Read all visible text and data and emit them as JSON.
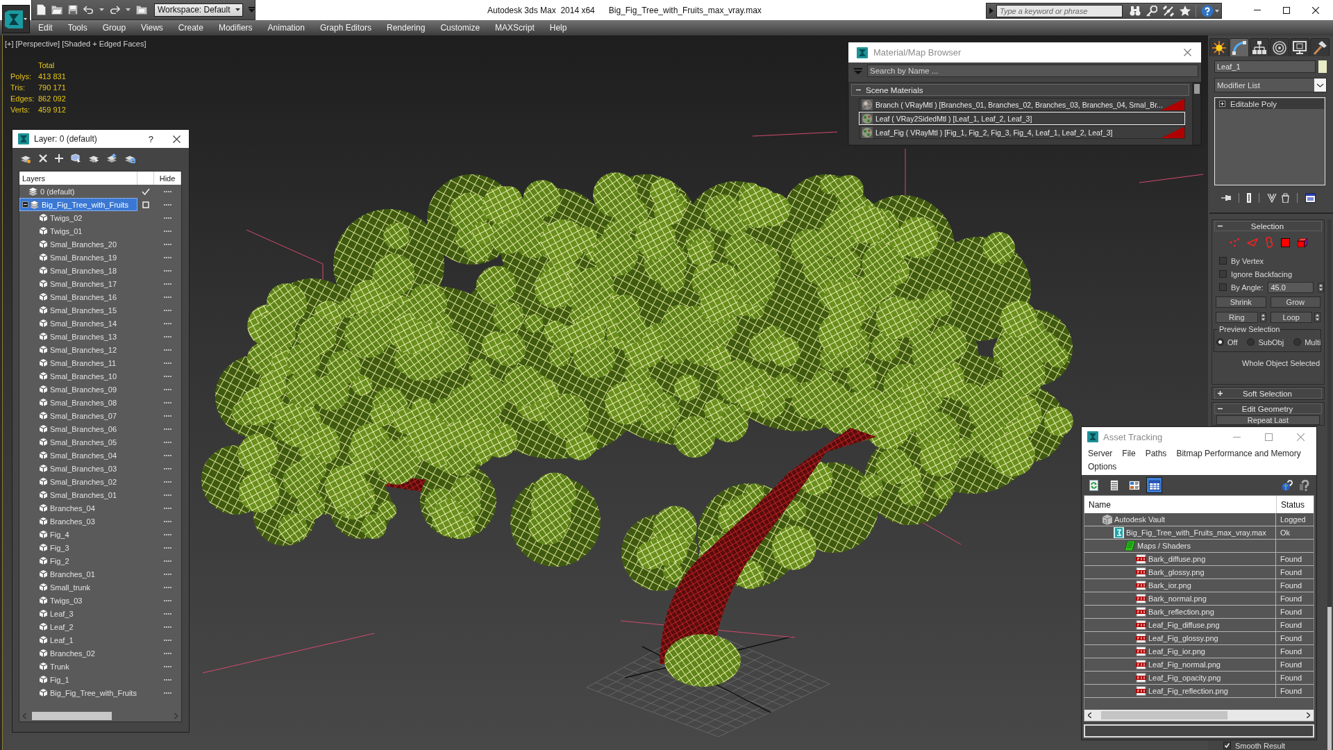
{
  "title_bar": {
    "workspace": "Workspace: Default",
    "app_title": "Autodesk 3ds Max  2014 x64",
    "file_name": "Big_Fig_Tree_with_Fruits_max_vray.max",
    "search": {
      "placeholder": "Type a keyword or phrase"
    }
  },
  "menu_bar": [
    "Edit",
    "Tools",
    "Group",
    "Views",
    "Create",
    "Modifiers",
    "Animation",
    "Graph Editors",
    "Rendering",
    "Customize",
    "MAXScript",
    "Help"
  ],
  "viewport": {
    "labels": [
      "[+]",
      "[Perspective]",
      "[Shaded + Edged Faces]"
    ],
    "stats": {
      "heading": "Total",
      "rows": [
        {
          "label": "Polys:",
          "value": "413 831"
        },
        {
          "label": "Tris:",
          "value": "790 171"
        },
        {
          "label": "Edges:",
          "value": "862 092"
        },
        {
          "label": "Verts:",
          "value": "459 912"
        }
      ]
    }
  },
  "layer_explorer": {
    "title": "Layer: 0 (default)",
    "help": "?",
    "columns": [
      "Layers",
      "Hide"
    ],
    "layers": [
      {
        "kind": "layer",
        "name": "0 (default)",
        "current": true,
        "selected": false
      },
      {
        "kind": "layer",
        "name": "Big_Fig_Tree_with_Fruits",
        "current": false,
        "selected": true,
        "expanded": true,
        "children": [
          {
            "kind": "object",
            "name": "Twigs_02",
            "selected": false
          },
          {
            "kind": "object",
            "name": "Twigs_01",
            "selected": false
          },
          {
            "kind": "object",
            "name": "Smal_Branches_20",
            "selected": false
          },
          {
            "kind": "object",
            "name": "Smal_Branches_19",
            "selected": false
          },
          {
            "kind": "object",
            "name": "Smal_Branches_18",
            "selected": false
          },
          {
            "kind": "object",
            "name": "Smal_Branches_17",
            "selected": false
          },
          {
            "kind": "object",
            "name": "Smal_Branches_16",
            "selected": false
          },
          {
            "kind": "object",
            "name": "Smal_Branches_15",
            "selected": false
          },
          {
            "kind": "object",
            "name": "Smal_Branches_14",
            "selected": false
          },
          {
            "kind": "object",
            "name": "Smal_Branches_13",
            "selected": false
          },
          {
            "kind": "object",
            "name": "Smal_Branches_12",
            "selected": false
          },
          {
            "kind": "object",
            "name": "Smal_Branches_11",
            "selected": false
          },
          {
            "kind": "object",
            "name": "Smal_Branches_10",
            "selected": false
          },
          {
            "kind": "object",
            "name": "Smal_Branches_09",
            "selected": false
          },
          {
            "kind": "object",
            "name": "Smal_Branches_08",
            "selected": false
          },
          {
            "kind": "object",
            "name": "Smal_Branches_07",
            "selected": false
          },
          {
            "kind": "object",
            "name": "Smal_Branches_06",
            "selected": false
          },
          {
            "kind": "object",
            "name": "Smal_Branches_05",
            "selected": false
          },
          {
            "kind": "object",
            "name": "Smal_Branches_04",
            "selected": false
          },
          {
            "kind": "object",
            "name": "Smal_Branches_03",
            "selected": false
          },
          {
            "kind": "object",
            "name": "Smal_Branches_02",
            "selected": false
          },
          {
            "kind": "object",
            "name": "Smal_Branches_01",
            "selected": false
          },
          {
            "kind": "object",
            "name": "Branches_04",
            "selected": false
          },
          {
            "kind": "object",
            "name": "Branches_03",
            "selected": false
          },
          {
            "kind": "object",
            "name": "Fig_4",
            "selected": false
          },
          {
            "kind": "object",
            "name": "Fig_3",
            "selected": false
          },
          {
            "kind": "object",
            "name": "Fig_2",
            "selected": false
          },
          {
            "kind": "object",
            "name": "Branches_01",
            "selected": false
          },
          {
            "kind": "object",
            "name": "Small_trunk",
            "selected": false
          },
          {
            "kind": "object",
            "name": "Twigs_03",
            "selected": false
          },
          {
            "kind": "object",
            "name": "Leaf_3",
            "selected": false
          },
          {
            "kind": "object",
            "name": "Leaf_2",
            "selected": false
          },
          {
            "kind": "object",
            "name": "Leaf_1",
            "selected": false
          },
          {
            "kind": "object",
            "name": "Branches_02",
            "selected": false
          },
          {
            "kind": "object",
            "name": "Trunk",
            "selected": false
          },
          {
            "kind": "object",
            "name": "Fig_1",
            "selected": false
          },
          {
            "kind": "object",
            "name": "Big_Fig_Tree_with_Fruits",
            "selected": false
          }
        ]
      }
    ]
  },
  "material_browser": {
    "title": "Material/Map Browser",
    "search": {
      "placeholder": "Search by Name ..."
    },
    "group": {
      "label": "Scene Materials",
      "expanded": true
    },
    "materials": [
      {
        "kind": "bark",
        "text": "Branch ( VRayMtl ) [Branches_01, Branches_02, Branches_03, Branches_04, Smal_Br...",
        "selected": false,
        "hot": true
      },
      {
        "kind": "leaf",
        "text": "Leaf ( VRay2SidedMtl ) [Leaf_1, Leaf_2, Leaf_3]",
        "selected": true,
        "hot": false
      },
      {
        "kind": "leaf",
        "text": "Leaf_Fig ( VRayMtl ) [Fig_1, Fig_2, Fig_3, Fig_4, Leaf_1, Leaf_2, Leaf_3]",
        "selected": false,
        "hot": true
      }
    ]
  },
  "command_panel": {
    "tabs": [
      {
        "kind": "create",
        "selected": false
      },
      {
        "kind": "modify",
        "selected": true
      },
      {
        "kind": "hierarchy",
        "selected": false
      },
      {
        "kind": "motion",
        "selected": false
      },
      {
        "kind": "display",
        "selected": false
      },
      {
        "kind": "utilities",
        "selected": false
      }
    ],
    "object_name": "Leaf_1",
    "modifier_list": "Modifier List",
    "stack": [
      {
        "name": "Editable Poly",
        "expanded": false
      }
    ],
    "rollouts": [
      {
        "title": "Selection",
        "expanded": true,
        "subobject_levels": [
          {
            "kind": "vertex",
            "selected": false
          },
          {
            "kind": "edge",
            "selected": false
          },
          {
            "kind": "border",
            "selected": false
          },
          {
            "kind": "polygon",
            "selected": false
          },
          {
            "kind": "element",
            "selected": false
          }
        ],
        "checkboxes": [
          {
            "label": "By Vertex",
            "checked": false
          },
          {
            "label": "Ignore Backfacing",
            "checked": false
          },
          {
            "label": "By Angle:",
            "checked": false,
            "value": "45.0"
          }
        ],
        "buttons": [
          {
            "kind": "plain",
            "label": "Shrink"
          },
          {
            "kind": "plain",
            "label": "Grow"
          },
          {
            "kind": "spinner",
            "label": "Ring"
          },
          {
            "kind": "spinner",
            "label": "Loop"
          }
        ],
        "preview_selection": {
          "label": "Preview Selection",
          "options": [
            {
              "label": "Off",
              "selected": true
            },
            {
              "label": "SubObj",
              "selected": false
            },
            {
              "label": "Multi",
              "selected": false
            }
          ]
        },
        "status": "Whole Object Selected"
      },
      {
        "title": "Soft Selection",
        "expanded": false
      },
      {
        "title": "Edit Geometry",
        "expanded": true,
        "buttons": [
          {
            "kind": "plain",
            "label": "Repeat Last"
          }
        ]
      }
    ],
    "smooth_result": {
      "label": "Smooth Result",
      "checked": true
    }
  },
  "asset_tracking": {
    "title": "Asset Tracking",
    "menu": [
      "Server",
      "File",
      "Paths",
      "Bitmap Performance and Memory",
      "Options"
    ],
    "view_modes": [
      {
        "kind": "refresh",
        "selected": false
      },
      {
        "kind": "list",
        "selected": false
      },
      {
        "kind": "thumbnails",
        "selected": false
      },
      {
        "kind": "table",
        "selected": true
      }
    ],
    "columns": [
      "Name",
      "Status"
    ],
    "rows": [
      {
        "kind": "vault",
        "name": "Autodesk Vault",
        "status": "Logged",
        "children": [
          {
            "kind": "scene",
            "name": "Big_Fig_Tree_with_Fruits_max_vray.max",
            "status": "Ok",
            "children": [
              {
                "kind": "folder",
                "name": "Maps / Shaders",
                "children": [
                  {
                    "kind": "png",
                    "name": "Bark_diffuse.png",
                    "status": "Found"
                  },
                  {
                    "kind": "png",
                    "name": "Bark_glossy.png",
                    "status": "Found"
                  },
                  {
                    "kind": "png",
                    "name": "Bark_ior.png",
                    "status": "Found"
                  },
                  {
                    "kind": "png",
                    "name": "Bark_normal.png",
                    "status": "Found"
                  },
                  {
                    "kind": "png",
                    "name": "Bark_reflection.png",
                    "status": "Found"
                  },
                  {
                    "kind": "png",
                    "name": "Leaf_Fig_diffuse.png",
                    "status": "Found"
                  },
                  {
                    "kind": "png",
                    "name": "Leaf_Fig_glossy.png",
                    "status": "Found"
                  },
                  {
                    "kind": "png",
                    "name": "Leaf_Fig_ior.png",
                    "status": "Found"
                  },
                  {
                    "kind": "png",
                    "name": "Leaf_Fig_normal.png",
                    "status": "Found"
                  },
                  {
                    "kind": "png",
                    "name": "Leaf_Fig_opacity.png",
                    "status": "Found"
                  },
                  {
                    "kind": "png",
                    "name": "Leaf_Fig_reflection.png",
                    "status": "Found"
                  }
                ]
              }
            ]
          }
        ]
      }
    ]
  }
}
